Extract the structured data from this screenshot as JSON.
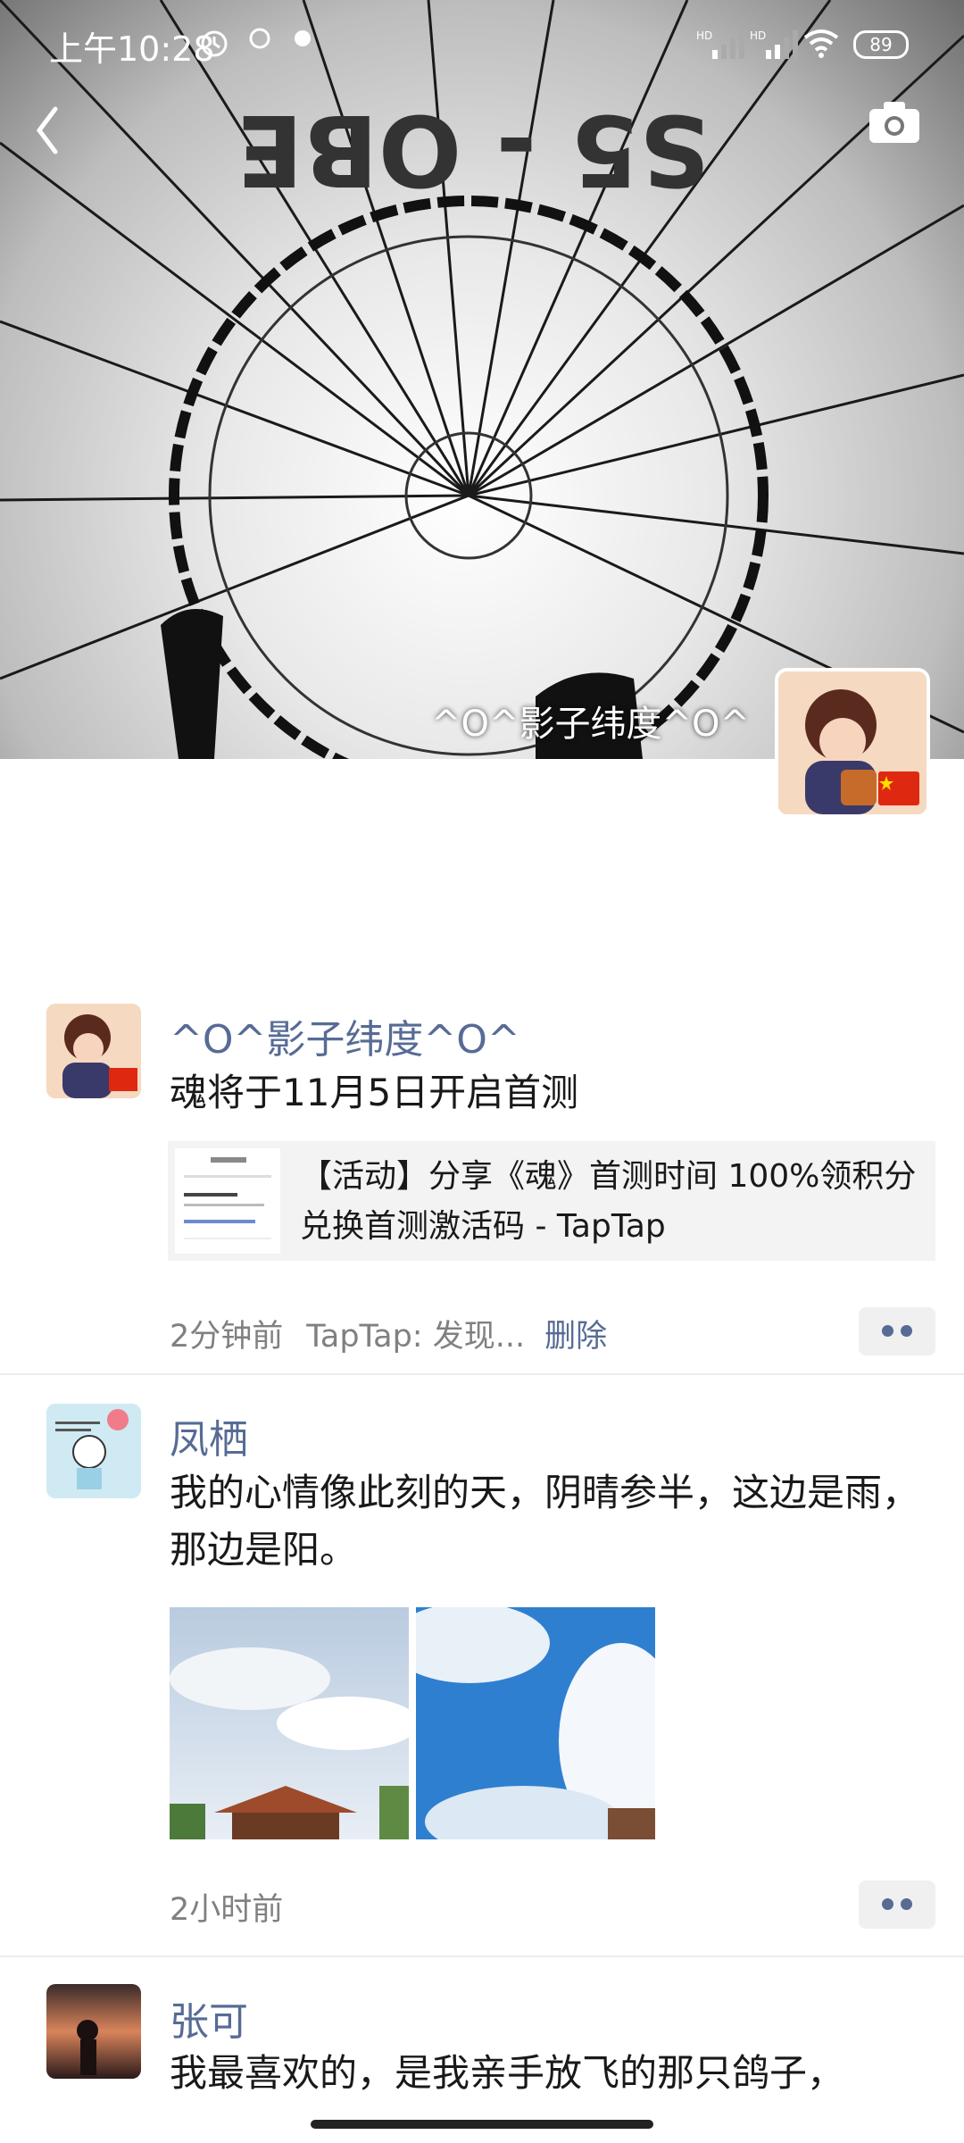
{
  "status_bar": {
    "time": "上午10:28",
    "battery": "89",
    "network_1": "HD",
    "network_2": "HD"
  },
  "cover": {
    "username": "^O^影子纬度^O^",
    "balloon_text": "S5 - OBE"
  },
  "posts": [
    {
      "author": "^O^影子纬度^O^",
      "text": "魂将于11月5日开启首测",
      "link_title": "【活动】分享《魂》首测时间 100%领积分兑换首测激活码 - TapTap",
      "time": "2分钟前",
      "source": "TapTap: 发现...",
      "delete_label": "删除"
    },
    {
      "author": "凤栖",
      "text": "我的心情像此刻的天，阴晴参半，这边是雨，那边是阳。",
      "time": "2小时前"
    },
    {
      "author": "张可",
      "text": "我最喜欢的，是我亲手放飞的那只鸽子，"
    }
  ],
  "colors": {
    "link_blue": "#576b95",
    "text": "#191919",
    "meta_gray": "#808080"
  }
}
